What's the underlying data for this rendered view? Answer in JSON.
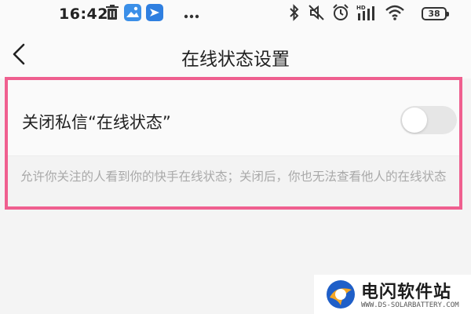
{
  "status_bar": {
    "time": "16:42",
    "left_icons": [
      "trash-icon",
      "gallery-app-icon",
      "message-app-icon",
      "more-dots-icon"
    ],
    "right_icons": [
      "bluetooth-icon",
      "mute-icon",
      "alarm-icon",
      "hd-signal-icon",
      "wifi-icon"
    ],
    "hd_label": "HD",
    "battery_level": "38"
  },
  "nav": {
    "back_icon": "chevron-left-icon",
    "title": "在线状态设置"
  },
  "setting": {
    "label": "关闭私信“在线状态”",
    "toggle_on": false,
    "description": "允许你关注的人看到你的快手在线状态；关闭后，你也无法查看他人的在线状态",
    "highlight_color": "#ef5f8f"
  },
  "watermark": {
    "title": "电闪软件站",
    "url": "WWW.DS-SOLARBATTERY.COM"
  }
}
